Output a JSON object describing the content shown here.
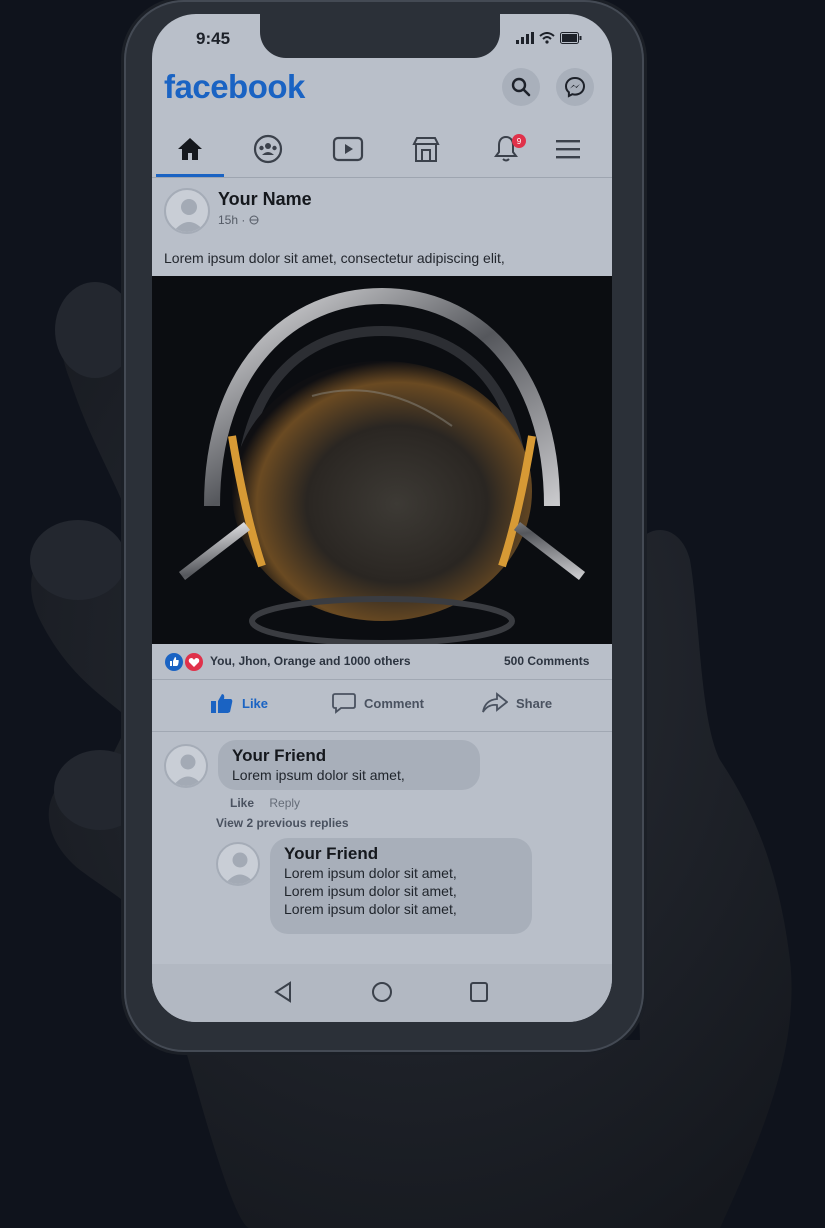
{
  "status": {
    "time": "9:45"
  },
  "app": {
    "logo": "facebook",
    "brand_color": "#1a63c3",
    "notification_badge": "9"
  },
  "icons": {
    "header": [
      "search-icon",
      "messenger-icon"
    ],
    "nav": [
      "home-icon",
      "groups-icon",
      "watch-icon",
      "marketplace-icon",
      "notifications-icon",
      "menu-icon"
    ]
  },
  "post": {
    "author": "Your Name",
    "time": "15h · ",
    "text": "Lorem ipsum dolor sit amet, consectetur adipiscing elit,",
    "reactions_text": "You, Jhon, Orange and 1000 others",
    "comments_count": "500 Comments"
  },
  "actions": {
    "like": "Like",
    "comment": "Comment",
    "share": "Share"
  },
  "comments": [
    {
      "name": "Your Friend",
      "lines": [
        "Lorem ipsum dolor sit amet,"
      ],
      "like": "Like",
      "reply": "Reply",
      "view_replies": "View 2 previous replies"
    }
  ],
  "reply": {
    "name": "Your Friend",
    "lines": [
      "Lorem ipsum dolor sit amet,",
      "Lorem ipsum dolor sit amet,",
      "Lorem ipsum dolor sit amet,"
    ]
  }
}
